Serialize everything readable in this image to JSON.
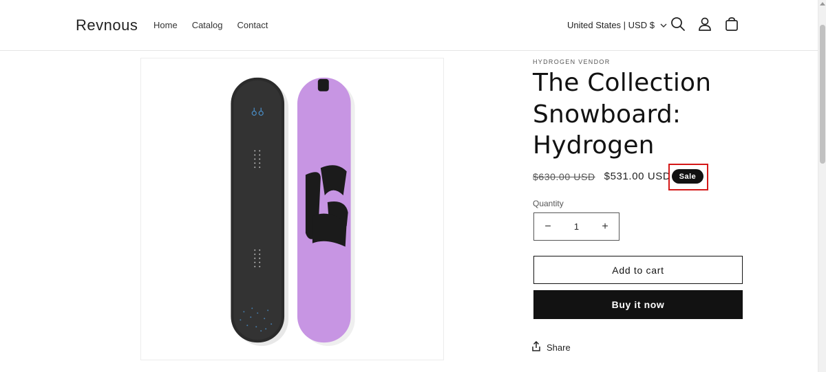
{
  "header": {
    "logo": "Revnous",
    "nav": [
      "Home",
      "Catalog",
      "Contact"
    ],
    "country": "United States | USD $"
  },
  "product": {
    "vendor": "HYDROGEN VENDOR",
    "title": "The Collection Snowboard: Hydrogen",
    "price_old": "$630.00 USD",
    "price_new": "$531.00 USD",
    "badge": "Sale",
    "quantity_label": "Quantity",
    "quantity_value": "1",
    "add_to_cart": "Add to cart",
    "buy_now": "Buy it now",
    "share": "Share"
  },
  "icons": [
    "search-icon",
    "account-icon",
    "cart-icon",
    "chevron-down-icon",
    "minus-icon",
    "plus-icon",
    "share-icon"
  ],
  "colors": {
    "badge_bg": "#121212",
    "highlight_border": "#d41717",
    "board_purple": "#c795e3",
    "board_black": "#2a2a2a"
  }
}
